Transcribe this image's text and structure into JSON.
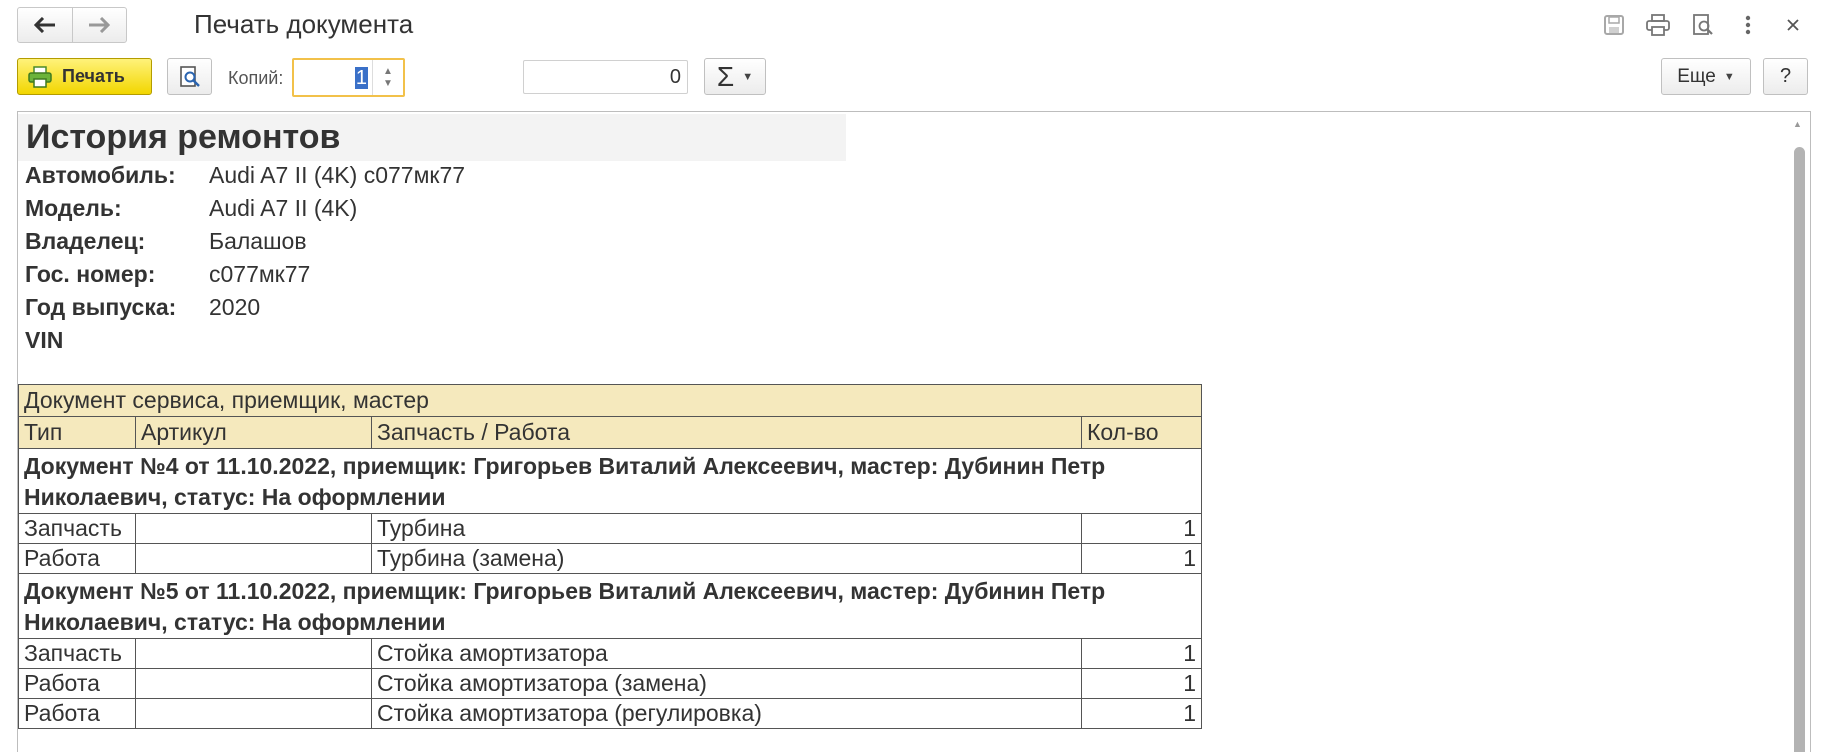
{
  "window": {
    "title": "Печать документа"
  },
  "toolbar": {
    "print_label": "Печать",
    "copies_label": "Копий:",
    "copies_value": "1",
    "sum_value": "0",
    "sum_symbol": "Σ",
    "more_label": "Еще",
    "help_label": "?"
  },
  "report": {
    "title": "История ремонтов",
    "info": [
      {
        "label": "Автомобиль:",
        "value": "Audi A7 II (4K) с077мк77"
      },
      {
        "label": "Модель:",
        "value": "Audi A7 II (4K)"
      },
      {
        "label": "Владелец:",
        "value": "Балашов"
      },
      {
        "label": "Гос. номер:",
        "value": "с077мк77"
      },
      {
        "label": "Год выпуска:",
        "value": "2020"
      },
      {
        "label": "VIN",
        "value": ""
      }
    ],
    "table": {
      "header_group": "Документ сервиса, приемщик, мастер",
      "columns": [
        "Тип",
        "Артикул",
        "Запчасть / Работа",
        "Кол-во"
      ],
      "groups": [
        {
          "title": "Документ №4 от 11.10.2022, приемщик: Григорьев Виталий Алексеевич, мастер: Дубинин Петр Николаевич, статус: На оформлении",
          "rows": [
            {
              "type": "Запчасть",
              "article": "",
              "item": "Турбина",
              "qty": "1"
            },
            {
              "type": "Работа",
              "article": "",
              "item": "Турбина (замена)",
              "qty": "1"
            }
          ]
        },
        {
          "title": "Документ №5 от 11.10.2022, приемщик: Григорьев Виталий Алексеевич, мастер: Дубинин Петр Николаевич, статус: На оформлении",
          "rows": [
            {
              "type": "Запчасть",
              "article": "",
              "item": "Стойка амортизатора",
              "qty": "1"
            },
            {
              "type": "Работа",
              "article": "",
              "item": "Стойка амортизатора (замена)",
              "qty": "1"
            },
            {
              "type": "Работа",
              "article": "",
              "item": "Стойка амортизатора (регулировка)",
              "qty": "1"
            }
          ]
        }
      ]
    }
  }
}
